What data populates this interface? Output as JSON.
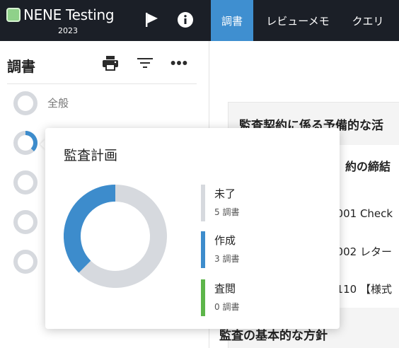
{
  "header": {
    "app_name": "NENE Testing",
    "year": "2023",
    "tabs": [
      {
        "label": "調書",
        "active": true
      },
      {
        "label": "レビューメモ",
        "active": false
      },
      {
        "label": "クエリ",
        "active": false
      }
    ]
  },
  "sidebar": {
    "title": "調書",
    "items": [
      {
        "label": "全般",
        "progress": 0
      },
      {
        "label": "",
        "progress": 0.375
      },
      {
        "label": "",
        "progress": 0
      },
      {
        "label": "",
        "progress": 0
      },
      {
        "label": "",
        "progress": 0
      }
    ]
  },
  "main": {
    "section_title": "監査契約に係る予備的な活",
    "subsection_title": "約の締結",
    "documents": [
      "1001 Check",
      "1002 レター",
      "1110 【様式"
    ],
    "next_section_title": "監査の基本的な方針"
  },
  "popover": {
    "title": "監査計画",
    "legend": [
      {
        "label": "未了",
        "count": "5 調書",
        "value": 5,
        "color": "#d6d9de"
      },
      {
        "label": "作成",
        "count": "3 調書",
        "value": 3,
        "color": "#3d8ccc"
      },
      {
        "label": "査閲",
        "count": "0 調書",
        "value": 0,
        "color": "#5db54a"
      }
    ]
  },
  "colors": {
    "header_bg": "#1b1f27",
    "active_tab": "#3f8fd0",
    "ring_track": "#d6d9de",
    "ring_progress": "#3d8ccc"
  }
}
